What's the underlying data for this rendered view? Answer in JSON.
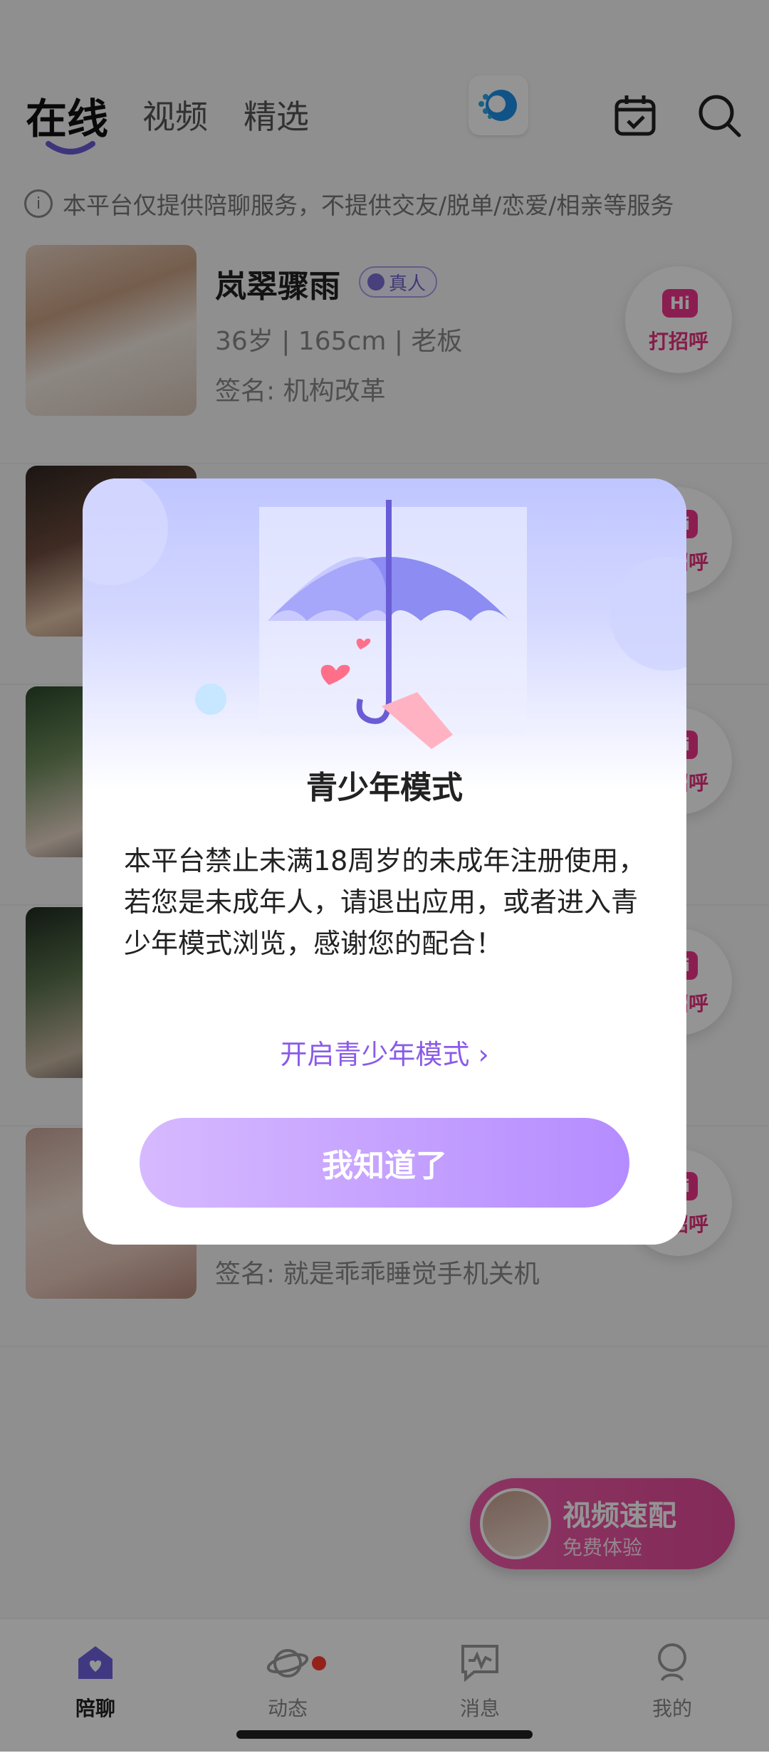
{
  "top_tabs": [
    "在线",
    "视频",
    "精选"
  ],
  "notice": "本平台仅提供陪聊服务，不提供交友/脱单/恋爱/相亲等服务",
  "list": {
    "items": [
      {
        "name": "岚翠骤雨",
        "badge": "真人",
        "meta": "36岁 | 165cm | 老板",
        "signature": "签名: 机构改革",
        "greet_label": "打招呼",
        "hi": "Hi"
      },
      {
        "name": "",
        "badge": "",
        "meta": "",
        "signature": "",
        "greet_label": "打招呼",
        "hi": "Hi"
      },
      {
        "name": "",
        "badge": "",
        "meta": "",
        "signature": "",
        "greet_label": "打招呼",
        "hi": "Hi"
      },
      {
        "name": "",
        "badge": "",
        "meta": "",
        "signature": "",
        "greet_label": "打招呼",
        "hi": "Hi"
      },
      {
        "name": "",
        "badge": "",
        "meta": "",
        "signature": "签名: 就是乖乖睡觉手机关机",
        "greet_label": "打招呼",
        "hi": "Hi"
      }
    ]
  },
  "modal": {
    "title": "青少年模式",
    "body": "本平台禁止未满18周岁的未成年注册使用，若您是未成年人，请退出应用，或者进入青少年模式浏览，感谢您的配合！",
    "link": "开启青少年模式 ›",
    "button": "我知道了"
  },
  "video_match": {
    "title": "视频速配",
    "subtitle": "免费体验"
  },
  "bottom_nav": [
    {
      "label": "陪聊",
      "icon": "home-heart-icon",
      "active": true
    },
    {
      "label": "动态",
      "icon": "planet-icon",
      "active": false
    },
    {
      "label": "消息",
      "icon": "message-icon",
      "active": false
    },
    {
      "label": "我的",
      "icon": "profile-icon",
      "active": false
    }
  ],
  "colors": {
    "accent": "#8a5be9",
    "button_start": "#d6b9ff",
    "button_end": "#b58cff",
    "hi_pink": "#f0358c"
  }
}
